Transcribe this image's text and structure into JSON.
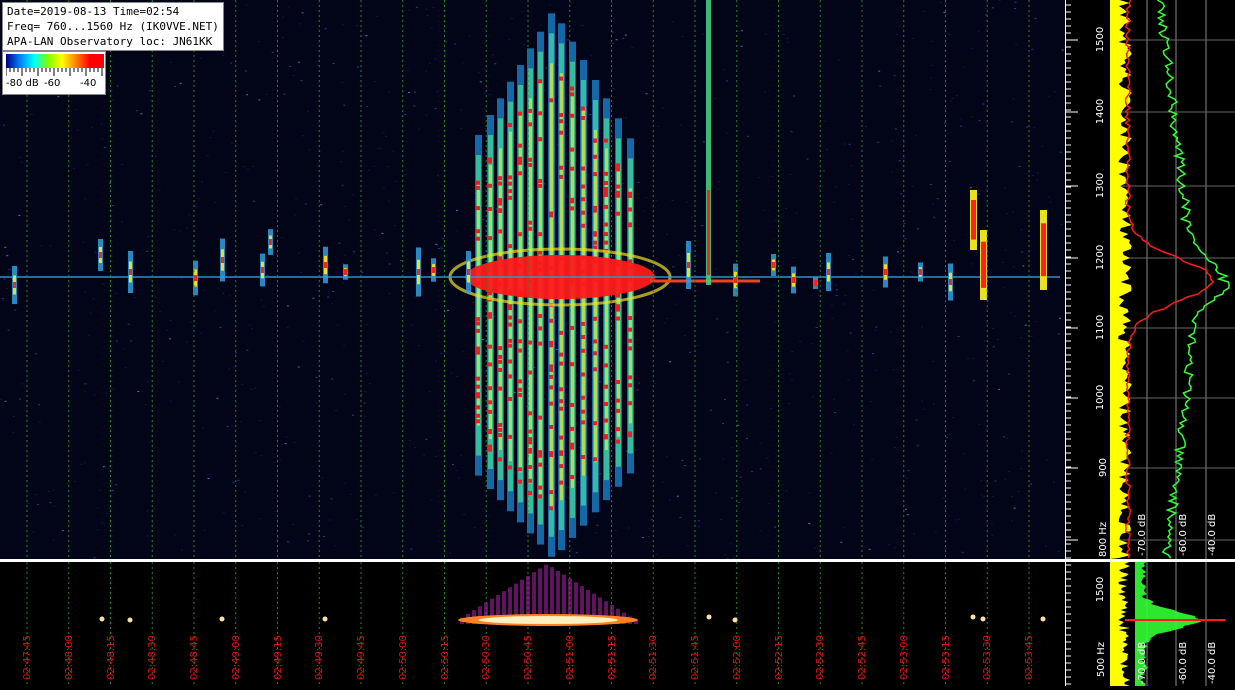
{
  "info": {
    "line1": "Date=2019-08-13 Time=02:54",
    "line2": "Freq= 760...1560 Hz (IK0VVE.NET)",
    "line3": "APA-LAN Observatory loc: JN61KK"
  },
  "legend": {
    "labels": [
      "-80 dB",
      "-60",
      "-40"
    ],
    "gradient": [
      "#000080",
      "#0080ff",
      "#00ffff",
      "#80ff00",
      "#ffff00",
      "#ff8000",
      "#ff0000",
      "#ff0000"
    ]
  },
  "time_axis": {
    "labels": [
      "02:47:45",
      "02:48:00",
      "02:48:15",
      "02:48:30",
      "02:48:45",
      "02:49:00",
      "02:49:15",
      "02:49:30",
      "02:49:45",
      "02:50:00",
      "02:50:15",
      "02:50:30",
      "02:50:45",
      "02:51:00",
      "02:51:15",
      "02:51:30",
      "02:51:45",
      "02:52:00",
      "02:52:15",
      "02:52:30",
      "02:52:45",
      "02:53:00",
      "02:53:15",
      "02:53:30",
      "02:53:45"
    ]
  },
  "freq_axis": {
    "labels": [
      "1500",
      "1400",
      "1300",
      "1200",
      "1100",
      "1000",
      "900",
      "800 Hz"
    ]
  },
  "freq_axis_bottom": {
    "labels": [
      "1500",
      "500 Hz"
    ]
  },
  "spectrum_scale": {
    "labels": [
      "-70.0 dB",
      "-60.0 dB",
      "-40.0 dB"
    ]
  },
  "spectrum_scale_bottom": {
    "labels": [
      "-70.0 dB",
      "-60.0 dB",
      "-40.0 dB"
    ]
  },
  "colors": {
    "grid": "#1f8a1f",
    "time_label": "#e01010",
    "noise": "#ffff00",
    "avg": "#ff1a1a",
    "peak": "#33ff33"
  }
}
